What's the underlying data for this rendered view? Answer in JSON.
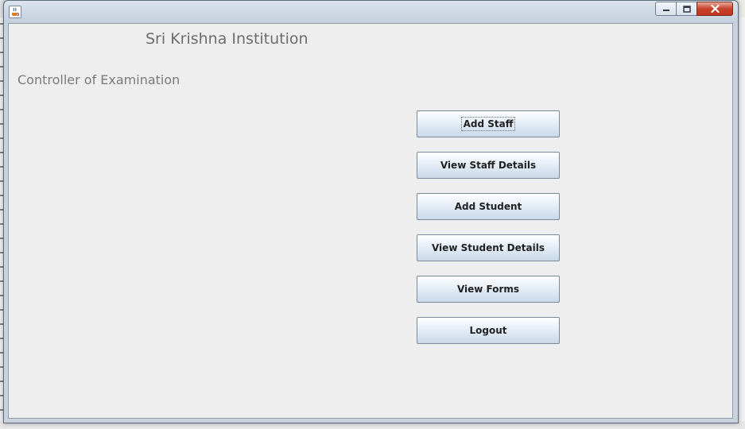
{
  "header": {
    "institution": "Sri Krishna Institution",
    "section": "Controller of Examination"
  },
  "menu": {
    "add_staff": "Add Staff",
    "view_staff_details": "View Staff Details",
    "add_student": "Add Student",
    "view_student_details": "View Student Details",
    "view_forms": "View Forms",
    "logout": "Logout"
  },
  "titlebar": {
    "icons": {
      "app": "java-cup-icon",
      "minimize": "minimize-icon",
      "maximize": "maximize-icon",
      "close": "close-icon"
    }
  },
  "colors": {
    "client_background": "#eeeeee",
    "button_gradient_top": "#ffffff",
    "button_gradient_bottom": "#c9d9ea",
    "title_text": "#6c6c6c",
    "close_button": "#c8432b"
  }
}
